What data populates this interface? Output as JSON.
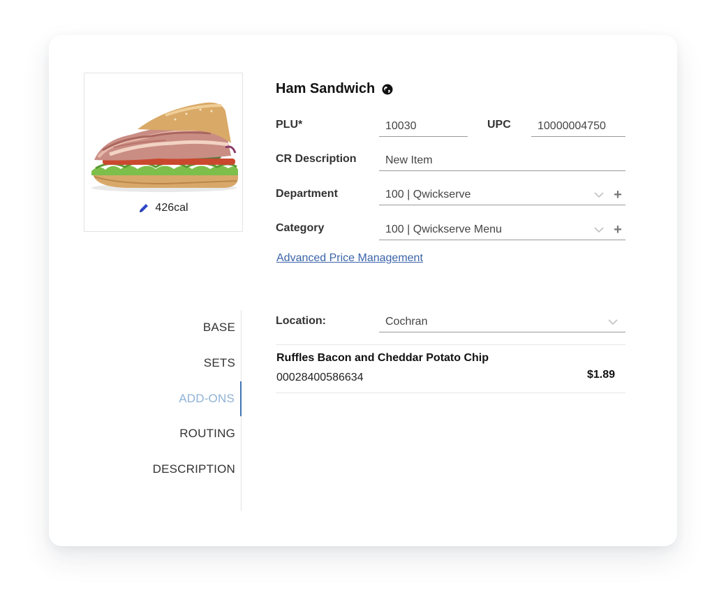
{
  "item": {
    "title": "Ham Sandwich",
    "title_icon": "globe-icon",
    "calories": "426cal",
    "calories_icon": "pencil-icon"
  },
  "fields": {
    "plu_label": "PLU*",
    "plu_value": "10030",
    "upc_label": "UPC",
    "upc_value": "10000004750",
    "cr_label": "CR Description",
    "cr_value": "New Item",
    "department_label": "Department",
    "department_value": "100 | Qwickserve",
    "category_label": "Category",
    "category_value": "100 | Qwickserve Menu"
  },
  "advanced_link": "Advanced Price Management",
  "nav": {
    "items": [
      {
        "label": "BASE"
      },
      {
        "label": "SETS"
      },
      {
        "label": "ADD-ONS"
      },
      {
        "label": "ROUTING"
      },
      {
        "label": "DESCRIPTION"
      }
    ],
    "active": "ADD-ONS"
  },
  "location": {
    "label": "Location:",
    "value": "Cochran"
  },
  "addons": [
    {
      "name": "Ruffles Bacon and Cheddar Potato Chip",
      "code": "00028400586634",
      "price": "$1.89"
    }
  ],
  "colors": {
    "link": "#3a63a8",
    "active_nav_text": "#8fb2d6",
    "active_nav_bar": "#3f74b4",
    "pencil": "#2f48c9"
  }
}
